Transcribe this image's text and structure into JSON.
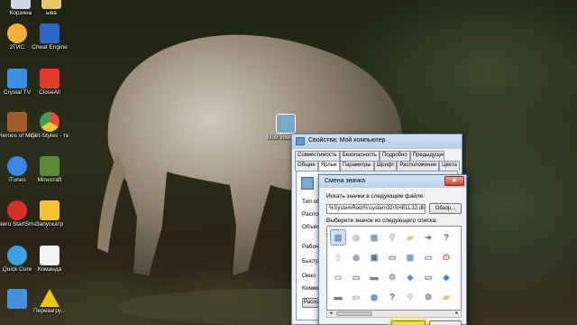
{
  "desktop": {
    "icons": [
      {
        "label": "Корзина",
        "icon": "recycle-bin-icon",
        "color": "#c9d6e3"
      },
      {
        "label": "ыва",
        "icon": "folder-icon",
        "color": "#e8c96a"
      },
      {
        "label": "2ГИС",
        "icon": "2gis-icon",
        "color": "#f3b13a"
      },
      {
        "label": "Cheat Engine",
        "icon": "cheat-engine-icon",
        "color": "#2f66c8"
      },
      {
        "label": "Crystal TV",
        "icon": "crystal-tv-icon",
        "color": "#3b8ee0"
      },
      {
        "label": "CloseAll",
        "icon": "close-all-icon",
        "color": "#e23a2a"
      },
      {
        "label": "Heroes of Might and ...",
        "icon": "heroes-icon",
        "color": "#a35a2a"
      },
      {
        "label": "Get-Styles - темы для ...",
        "icon": "chrome-icon",
        "color": "#e84a3a"
      },
      {
        "label": "iTunes",
        "icon": "itunes-icon",
        "color": "#3a86e0"
      },
      {
        "label": "Minecraft",
        "icon": "minecraft-icon",
        "color": "#5c8a36"
      },
      {
        "label": "Nero StartSmart",
        "icon": "nero-icon",
        "color": "#d83028"
      },
      {
        "label": "Запускатр",
        "icon": "launcher-icon",
        "color": "#f4c232"
      },
      {
        "label": "Quick Cure",
        "icon": "quick-cure-icon",
        "color": "#3aa0e0"
      },
      {
        "label": "Команда",
        "icon": "document-icon",
        "color": "#f2f2f2"
      },
      {
        "label": "",
        "icon": "network-icon",
        "color": "#4a90d8"
      },
      {
        "label": "Перезагру...",
        "icon": "warning-icon",
        "color": "#f1c30f"
      },
      {
        "label": "Мой компьютер",
        "icon": "my-computer-icon",
        "color": "#7aa6c8"
      }
    ]
  },
  "props_window": {
    "title": "Свойства: Мой компьютер",
    "tabs_row1": [
      "Совместимость",
      "Безопасность",
      "Подробно",
      "Предыдущие версии"
    ],
    "tabs_row2": [
      "Общие",
      "Ярлык",
      "Параметры",
      "Шрифт",
      "Расположение",
      "Цвета"
    ],
    "labels": [
      "Тип об",
      "Распол",
      "Объект",
      "Рабоча",
      "Быстры",
      "Окно",
      "Коммен",
      "Распо"
    ]
  },
  "change_icon_dialog": {
    "title": "Смена значка",
    "close_symbol": "✕",
    "search_label": "Искать значки в следующем файле:",
    "path_value": "%SystemRoot%\\system32\\SHELL32.dll",
    "browse_label": "Обзор...",
    "list_label": "Выберите значок из следующего списка:",
    "ok_label": "",
    "cancel_label": "",
    "scroll_left": "◄",
    "scroll_right": "►",
    "icons": [
      {
        "name": "document-icon",
        "glyph": "▤",
        "color": "#6a8fd0"
      },
      {
        "name": "generic-file-icon",
        "glyph": "▯",
        "color": "#ffffff"
      },
      {
        "name": "drive-icon",
        "glyph": "▭",
        "color": "#a6a6a6"
      },
      {
        "name": "disk-icon",
        "glyph": "▬",
        "color": "#7a7a7a"
      },
      {
        "name": "cd-drive-icon",
        "glyph": "◎",
        "color": "#bfbfbf"
      },
      {
        "name": "cd-icon",
        "glyph": "◉",
        "color": "#9ab"
      },
      {
        "name": "network-drive-icon",
        "glyph": "▭",
        "color": "#5a9f5a"
      },
      {
        "name": "card-icon",
        "glyph": "▭",
        "color": "#b0c4de"
      },
      {
        "name": "calendar-icon",
        "glyph": "▦",
        "color": "#8fb0d8"
      },
      {
        "name": "cpu-icon",
        "glyph": "▣",
        "color": "#4c6c8c"
      },
      {
        "name": "printer-icon",
        "glyph": "▬",
        "color": "#808080"
      },
      {
        "name": "globe-icon",
        "glyph": "◍",
        "color": "#3a86d0"
      },
      {
        "name": "magnifier-icon",
        "glyph": "⚲",
        "color": "#d8dde3"
      },
      {
        "name": "monitor-icon",
        "glyph": "▭",
        "color": "#3a78c0"
      },
      {
        "name": "recycle-icon",
        "glyph": "♻",
        "color": "#9ab"
      },
      {
        "name": "help-icon",
        "glyph": "?",
        "color": "#2a6ac8"
      },
      {
        "name": "folder-icon",
        "glyph": "▰",
        "color": "#e8c96a"
      },
      {
        "name": "computer-icon",
        "glyph": "▣",
        "color": "#7aa6c8"
      },
      {
        "name": "network-icon",
        "glyph": "◈",
        "color": "#4a90d8"
      },
      {
        "name": "magnifier-icon",
        "glyph": "⚲",
        "color": "#e8eef5"
      },
      {
        "name": "arrow-icon",
        "glyph": "➜",
        "color": "#5aa55a"
      },
      {
        "name": "window-icon",
        "glyph": "▭",
        "color": "#5a8ed0"
      },
      {
        "name": "monitor-icon",
        "glyph": "▭",
        "color": "#4a7ab8"
      },
      {
        "name": "settings-icon",
        "glyph": "⚙",
        "color": "#8a8a8a"
      },
      {
        "name": "help-icon",
        "glyph": "?",
        "color": "#2a6ac8"
      },
      {
        "name": "power-icon",
        "glyph": "⏻",
        "color": "#d84a2a"
      },
      {
        "name": "shield-icon",
        "glyph": "◆",
        "color": "#3a86d0"
      },
      {
        "name": "folder-icon",
        "glyph": "▰",
        "color": "#e8c96a"
      }
    ]
  }
}
